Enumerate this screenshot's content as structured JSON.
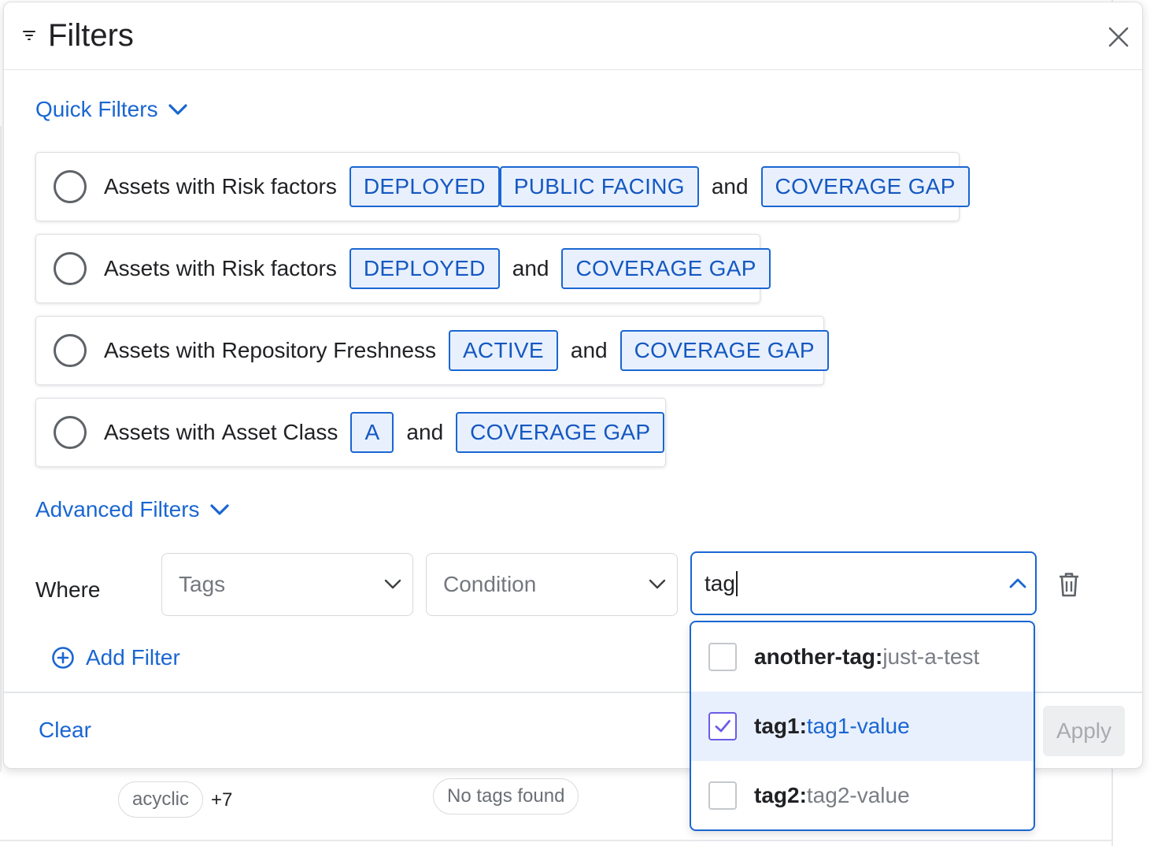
{
  "panel": {
    "title": "Filters"
  },
  "quick_filters": {
    "label": "Quick Filters",
    "items": [
      {
        "prefix": "Assets with",
        "field": "Risk factors",
        "tags": [
          "DEPLOYED",
          "PUBLIC FACING"
        ],
        "conj": "and",
        "last_tag": "COVERAGE GAP"
      },
      {
        "prefix": "Assets with",
        "field": "Risk factors",
        "tags": [
          "DEPLOYED"
        ],
        "conj": "and",
        "last_tag": "COVERAGE GAP"
      },
      {
        "prefix": "Assets with",
        "field": "Repository Freshness",
        "tags": [
          "ACTIVE"
        ],
        "conj": "and",
        "last_tag": "COVERAGE GAP"
      },
      {
        "prefix": "Assets with",
        "field": "Asset Class",
        "tags": [
          "A"
        ],
        "conj": "and",
        "last_tag": "COVERAGE GAP"
      }
    ]
  },
  "advanced_filters": {
    "label": "Advanced Filters",
    "where_label": "Where",
    "field_select": {
      "placeholder": "Tags"
    },
    "condition_select": {
      "placeholder": "Condition"
    },
    "value_input": {
      "value": "tag"
    },
    "add_filter_label": "Add Filter"
  },
  "dropdown": {
    "options": [
      {
        "key": "another-tag",
        "sep": ":",
        "value": "just-a-test",
        "checked": false
      },
      {
        "key": "tag1",
        "sep": ":",
        "value": "tag1-value",
        "checked": true
      },
      {
        "key": "tag2",
        "sep": ":",
        "value": "tag2-value",
        "checked": false
      }
    ]
  },
  "footer": {
    "clear_label": "Clear",
    "apply_label": "Apply"
  },
  "background": {
    "chip_acyclic": "acyclic",
    "more_count": "+7",
    "no_tags": "No tags found"
  },
  "colors": {
    "accent": "#1a66d2",
    "tag_bg": "#e8f0fe",
    "checkbox_checked": "#6b5ce7"
  }
}
